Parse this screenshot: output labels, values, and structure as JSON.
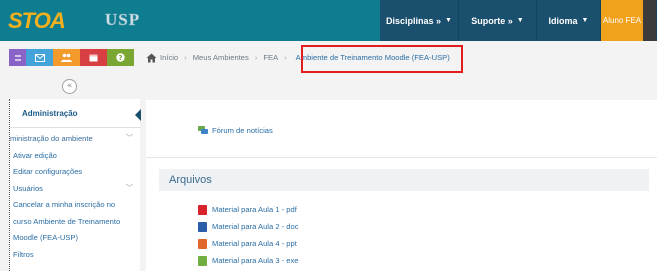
{
  "header": {
    "logo_text": "STOA",
    "logo_sub": "USP",
    "nav": [
      {
        "label": "Disciplinas »",
        "caret": "▼"
      },
      {
        "label": "Suporte »",
        "caret": "▼"
      },
      {
        "label": "Idioma",
        "caret": "▼"
      }
    ],
    "user_label": "Aluno FEA",
    "colors": {
      "navbar": "#0d7d8f",
      "nav_dark": "#1a4f6e",
      "user": "#f0a21c",
      "logo": "#f2b01e"
    }
  },
  "toolbar_icons": [
    "switch-icon",
    "mail-icon",
    "users-icon",
    "calendar-icon",
    "help-icon"
  ],
  "collapse_symbol": "«",
  "breadcrumb": {
    "items": [
      "Início",
      "Meus Ambientes",
      "FEA"
    ],
    "current": "Ambiente de Treinamento Moodle (FEA-USP)",
    "separator": "›"
  },
  "admin": {
    "title": "Administração",
    "items": [
      {
        "label": "ministração do ambiente",
        "expandable": true
      },
      {
        "label": "Ativar edição"
      },
      {
        "label": "Editar configurações"
      },
      {
        "label": "Usuários",
        "expandable": true
      }
    ],
    "unenrol": "Cancelar a minha inscrição no curso Ambiente de Treinamento Moodle (FEA-USP)",
    "filters": "Filtros"
  },
  "main": {
    "forum_label": "Fórum de notícias",
    "section_title": "Arquivos",
    "files": [
      {
        "label": "Material para Aula 1 - pdf",
        "icon": "pdf-icon"
      },
      {
        "label": "Material para Aula 2 - doc",
        "icon": "doc-icon"
      },
      {
        "label": "Material para Aula 4 - ppt",
        "icon": "ppt-icon"
      },
      {
        "label": "Material para Aula 3 - exe",
        "icon": "exe-icon"
      }
    ]
  }
}
